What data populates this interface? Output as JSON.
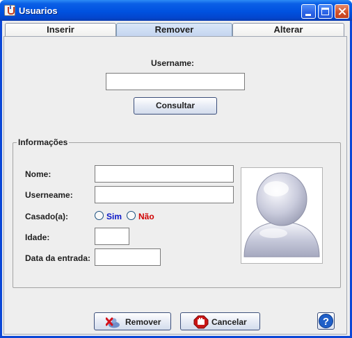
{
  "window": {
    "title": "Usuarios",
    "icon": "java-cup-icon",
    "controls": [
      "minimize-icon",
      "maximize-icon",
      "close-icon"
    ]
  },
  "tabs": [
    {
      "label": "Inserir"
    },
    {
      "label": "Remover",
      "selected": true
    },
    {
      "label": "Alterar"
    }
  ],
  "search": {
    "username_label": "Username:",
    "username_value": "",
    "consult_button": "Consultar"
  },
  "info": {
    "legend": "Informações",
    "nome_label": "Nome:",
    "nome_value": "",
    "userneame_label": "Userneame:",
    "userneame_value": "",
    "casado_label": "Casado(a):",
    "sim_label": "Sim",
    "nao_label": "Não",
    "idade_label": "Idade:",
    "idade_value": "",
    "data_label": "Data da entrada:",
    "data_value": "",
    "photo_icon": "user-avatar-icon"
  },
  "actions": {
    "remove_label": "Remover",
    "cancel_label": "Cancelar",
    "help_icon": "help-icon"
  },
  "colors": {
    "sim": "#0a16c8",
    "nao": "#d00000",
    "titlebar": "#0052e0"
  }
}
